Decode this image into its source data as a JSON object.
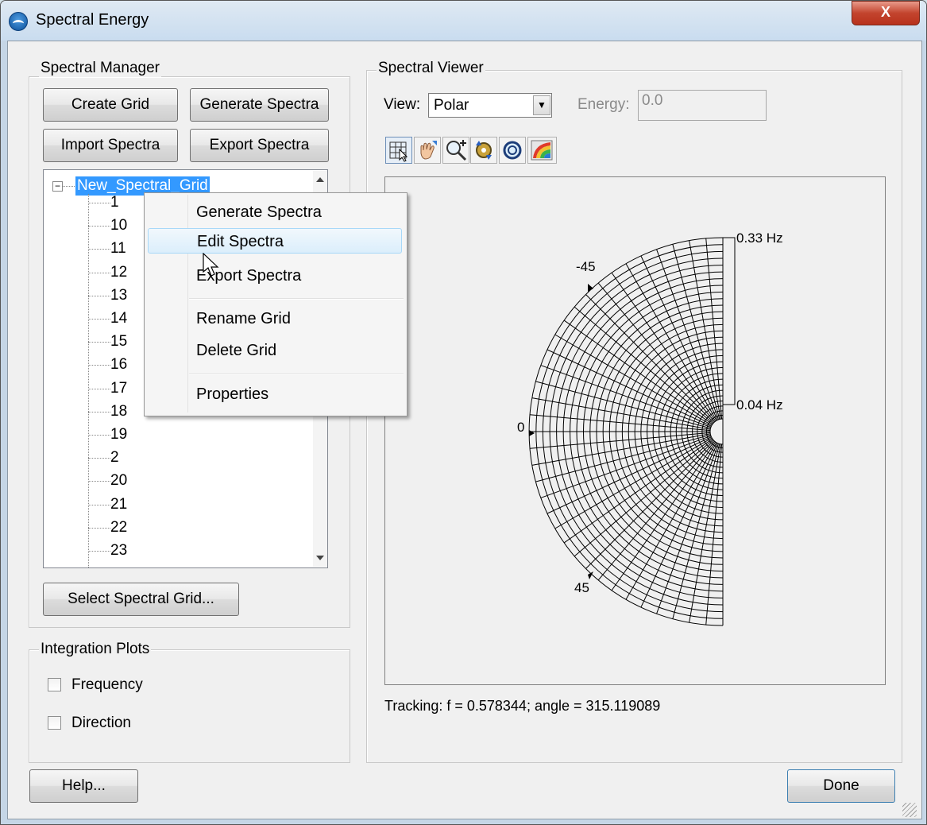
{
  "window": {
    "title": "Spectral Energy",
    "close_glyph": "X"
  },
  "spectral_manager": {
    "label": "Spectral Manager",
    "buttons": {
      "create_grid": "Create Grid",
      "generate_spectra": "Generate Spectra",
      "import_spectra": "Import Spectra",
      "export_spectra": "Export Spectra",
      "select_grid": "Select Spectral Grid..."
    },
    "tree": {
      "root": "New_Spectral_Grid",
      "toggle": "−",
      "items": [
        "1",
        "10",
        "11",
        "12",
        "13",
        "14",
        "15",
        "16",
        "17",
        "18",
        "19",
        "2",
        "20",
        "21",
        "22",
        "23"
      ]
    }
  },
  "context_menu": {
    "items": [
      "Generate Spectra",
      "Edit Spectra",
      "Export Spectra",
      "Rename Grid",
      "Delete Grid",
      "Properties"
    ],
    "active_index": 1
  },
  "integration_plots": {
    "label": "Integration Plots",
    "frequency": {
      "label": "Frequency",
      "checked": false
    },
    "direction": {
      "label": "Direction",
      "checked": false
    }
  },
  "spectral_viewer": {
    "label": "Spectral Viewer",
    "view_label": "View:",
    "view_value": "Polar",
    "energy_label": "Energy:",
    "energy_value": "0.0",
    "toolbar_icons": [
      "select-grid-icon",
      "pan-icon",
      "zoom-in-icon",
      "rotate-icon",
      "zoom-extents-icon",
      "color-ramp-icon"
    ],
    "polar_plot": {
      "freq_labels": [
        "0.33 Hz",
        "0.04 Hz"
      ],
      "angle_labels": [
        "-45",
        "0",
        "45"
      ]
    },
    "tracking": "Tracking: f = 0.578344; angle = 315.119089"
  },
  "footer": {
    "help": "Help...",
    "done": "Done"
  }
}
